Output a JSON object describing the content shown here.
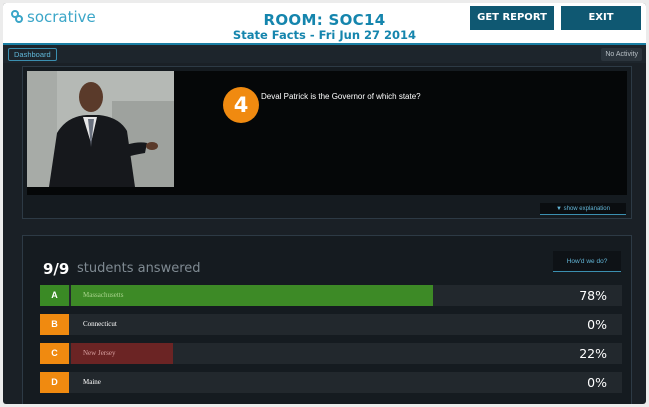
{
  "app": {
    "logo_text": "socrative"
  },
  "header": {
    "room_title": "ROOM: SOC14",
    "subtitle": "State Facts - Fri Jun 27 2014",
    "report_label": "GET REPORT",
    "exit_label": "EXIT"
  },
  "subbar": {
    "dashboard_tab": "Dashboard",
    "activity_status": "No Activity"
  },
  "question": {
    "number": "4",
    "text": "Deval Patrick is the Governor of which state?",
    "show_explanation": "▼ show explanation"
  },
  "results": {
    "count": "9/9",
    "label": "students answered",
    "how_label": "How'd we do?",
    "answers": [
      {
        "letter": "A",
        "text": "Massachusetts",
        "percent": "78%",
        "value": 78,
        "letter_color": "#3a8a25",
        "bar_color": "#3d8a26",
        "text_color": "#a9d48d"
      },
      {
        "letter": "B",
        "text": "Connecticut",
        "percent": "0%",
        "value": 0,
        "letter_color": "#f08a10",
        "bar_color": "#6b2424",
        "text_color": "#ffffff"
      },
      {
        "letter": "C",
        "text": "New Jersey",
        "percent": "22%",
        "value": 22,
        "letter_color": "#f08a10",
        "bar_color": "#6b2424",
        "text_color": "#d8a0a0"
      },
      {
        "letter": "D",
        "text": "Maine",
        "percent": "0%",
        "value": 0,
        "letter_color": "#f08a10",
        "bar_color": "#6b2424",
        "text_color": "#ffffff"
      }
    ]
  }
}
